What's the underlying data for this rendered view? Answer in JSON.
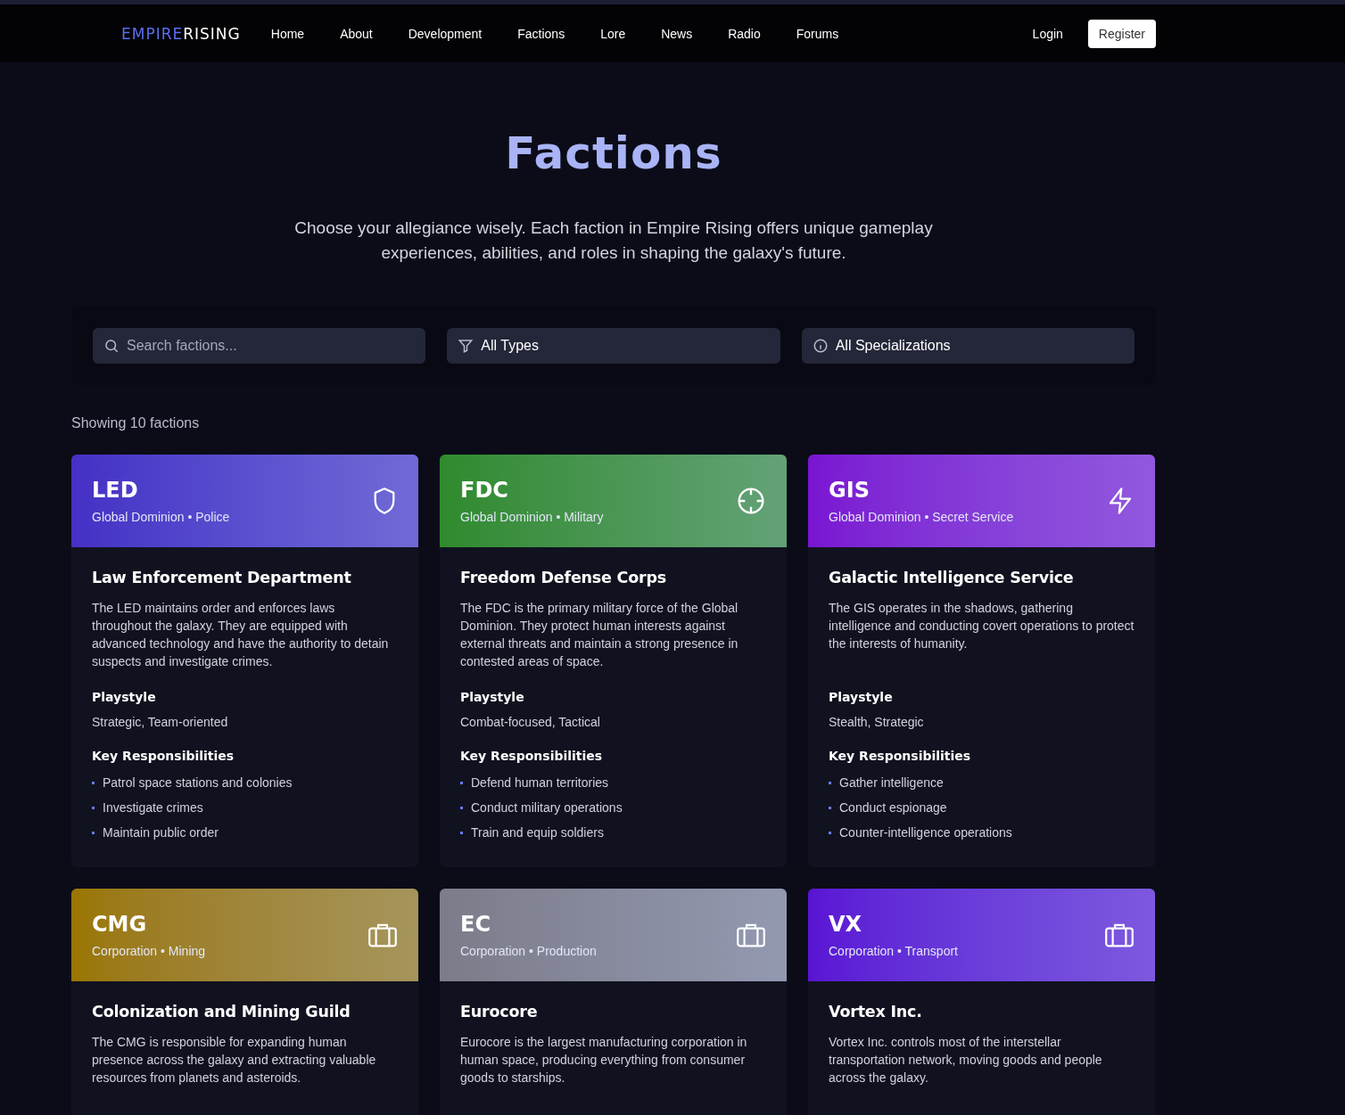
{
  "nav": {
    "logo_part1": "EMPIRE",
    "logo_part2": "RISING",
    "links": [
      {
        "label": "Home"
      },
      {
        "label": "About"
      },
      {
        "label": "Development"
      },
      {
        "label": "Factions"
      },
      {
        "label": "Lore"
      },
      {
        "label": "News"
      },
      {
        "label": "Radio"
      },
      {
        "label": "Forums"
      }
    ],
    "login": "Login",
    "register": "Register"
  },
  "hero": {
    "title": "Factions",
    "subtitle": "Choose your allegiance wisely. Each faction in Empire Rising offers unique gameplay experiences, abilities, and roles in shaping the galaxy's future."
  },
  "filters": {
    "search_placeholder": "Search factions...",
    "type": "All Types",
    "specialization": "All Specializations"
  },
  "count": "Showing 10 factions",
  "factions": [
    {
      "code": "LED",
      "tagline": "Global Dominion • Police",
      "kind": "shield",
      "color": "#4530c6",
      "name": "Law Enforcement Department",
      "description": "The LED maintains order and enforces laws throughout the galaxy. They are equipped with advanced technology and have the authority to detain suspects and investigate crimes.",
      "playstyle_label": "Playstyle",
      "playstyle": "Strategic, Team-oriented",
      "resp_label": "Key Responsibilities",
      "responsibilities": [
        "Patrol space stations and colonies",
        "Investigate crimes",
        "Maintain public order"
      ]
    },
    {
      "code": "FDC",
      "tagline": "Global Dominion • Military",
      "kind": "crosshair",
      "color": "#2f8a2c",
      "name": "Freedom Defense Corps",
      "description": "The FDC is the primary military force of the Global Dominion. They protect human interests against external threats and maintain a strong presence in contested areas of space.",
      "playstyle_label": "Playstyle",
      "playstyle": "Combat-focused, Tactical",
      "resp_label": "Key Responsibilities",
      "responsibilities": [
        "Defend human territories",
        "Conduct military operations",
        "Train and equip soldiers"
      ]
    },
    {
      "code": "GIS",
      "tagline": "Global Dominion • Secret Service",
      "kind": "bolt",
      "color": "#7a14d2",
      "name": "Galactic Intelligence Service",
      "description": "The GIS operates in the shadows, gathering intelligence and conducting covert operations to protect the interests of humanity.",
      "playstyle_label": "Playstyle",
      "playstyle": "Stealth, Strategic",
      "resp_label": "Key Responsibilities",
      "responsibilities": [
        "Gather intelligence",
        "Conduct espionage",
        "Counter-intelligence operations"
      ]
    },
    {
      "code": "CMG",
      "tagline": "Corporation • Mining",
      "kind": "briefcase",
      "color": "#9a7600",
      "name": "Colonization and Mining Guild",
      "description": "The CMG is responsible for expanding human presence across the galaxy and extracting valuable resources from planets and asteroids."
    },
    {
      "code": "EC",
      "tagline": "Corporation • Production",
      "kind": "briefcase",
      "color": "#7c7c8a",
      "name": "Eurocore",
      "description": "Eurocore is the largest manufacturing corporation in human space, producing everything from consumer goods to starships."
    },
    {
      "code": "VX",
      "tagline": "Corporation • Transport",
      "kind": "briefcase",
      "color": "#5a14d4",
      "name": "Vortex Inc.",
      "description": "Vortex Inc. controls most of the interstellar transportation network, moving goods and people across the galaxy."
    }
  ]
}
